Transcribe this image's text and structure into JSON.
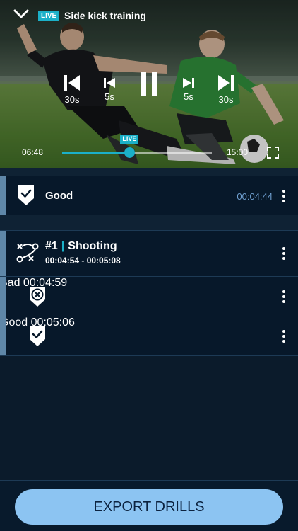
{
  "player": {
    "live_tag": "LIVE",
    "title": "Side kick training",
    "controls": {
      "back30": "30s",
      "back5": "5s",
      "fwd5": "5s",
      "fwd30": "30s"
    },
    "current_time": "06:48",
    "end_time": "15:00",
    "live_marker": "LIVE",
    "progress": 0.45,
    "live_position": 0.45
  },
  "events": [
    {
      "verdict": "Good",
      "icon": "check-badge-icon",
      "time": "00:04:44"
    }
  ],
  "drill": {
    "number": "#1",
    "name": "Shooting",
    "range": "00:04:54 - 00:05:08",
    "icon": "tactics-play-icon",
    "events": [
      {
        "verdict": "Bad",
        "icon": "x-badge-icon",
        "time": "00:04:59"
      },
      {
        "verdict": "Good",
        "icon": "check-badge-icon",
        "time": "00:05:06"
      }
    ]
  },
  "footer": {
    "export_label": "EXPORT DRILLS"
  },
  "colors": {
    "accent": "#1bb0c8",
    "background": "#0b1b2b",
    "time_text": "#6f9fd0",
    "button": "#8cc4f2"
  }
}
